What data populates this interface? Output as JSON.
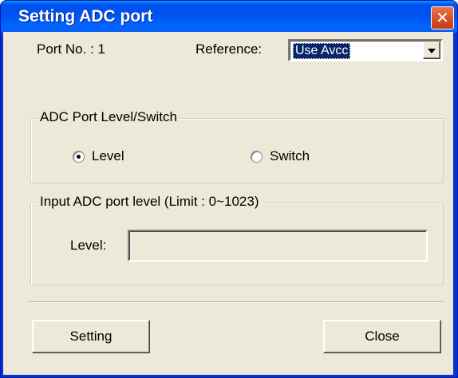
{
  "window": {
    "title": "Setting ADC port",
    "close_glyph": "✕"
  },
  "port": {
    "label": "Port No. : 1"
  },
  "reference": {
    "label": "Reference:",
    "selected": "Use Avcc"
  },
  "mode_group": {
    "title": "ADC Port Level/Switch",
    "options": [
      {
        "label": "Level",
        "checked": true
      },
      {
        "label": "Switch",
        "checked": false
      }
    ]
  },
  "input_group": {
    "title": "Input ADC port level (Limit : 0~1023)",
    "level_label": "Level:",
    "level_value": ""
  },
  "buttons": {
    "setting": "Setting",
    "close": "Close"
  }
}
